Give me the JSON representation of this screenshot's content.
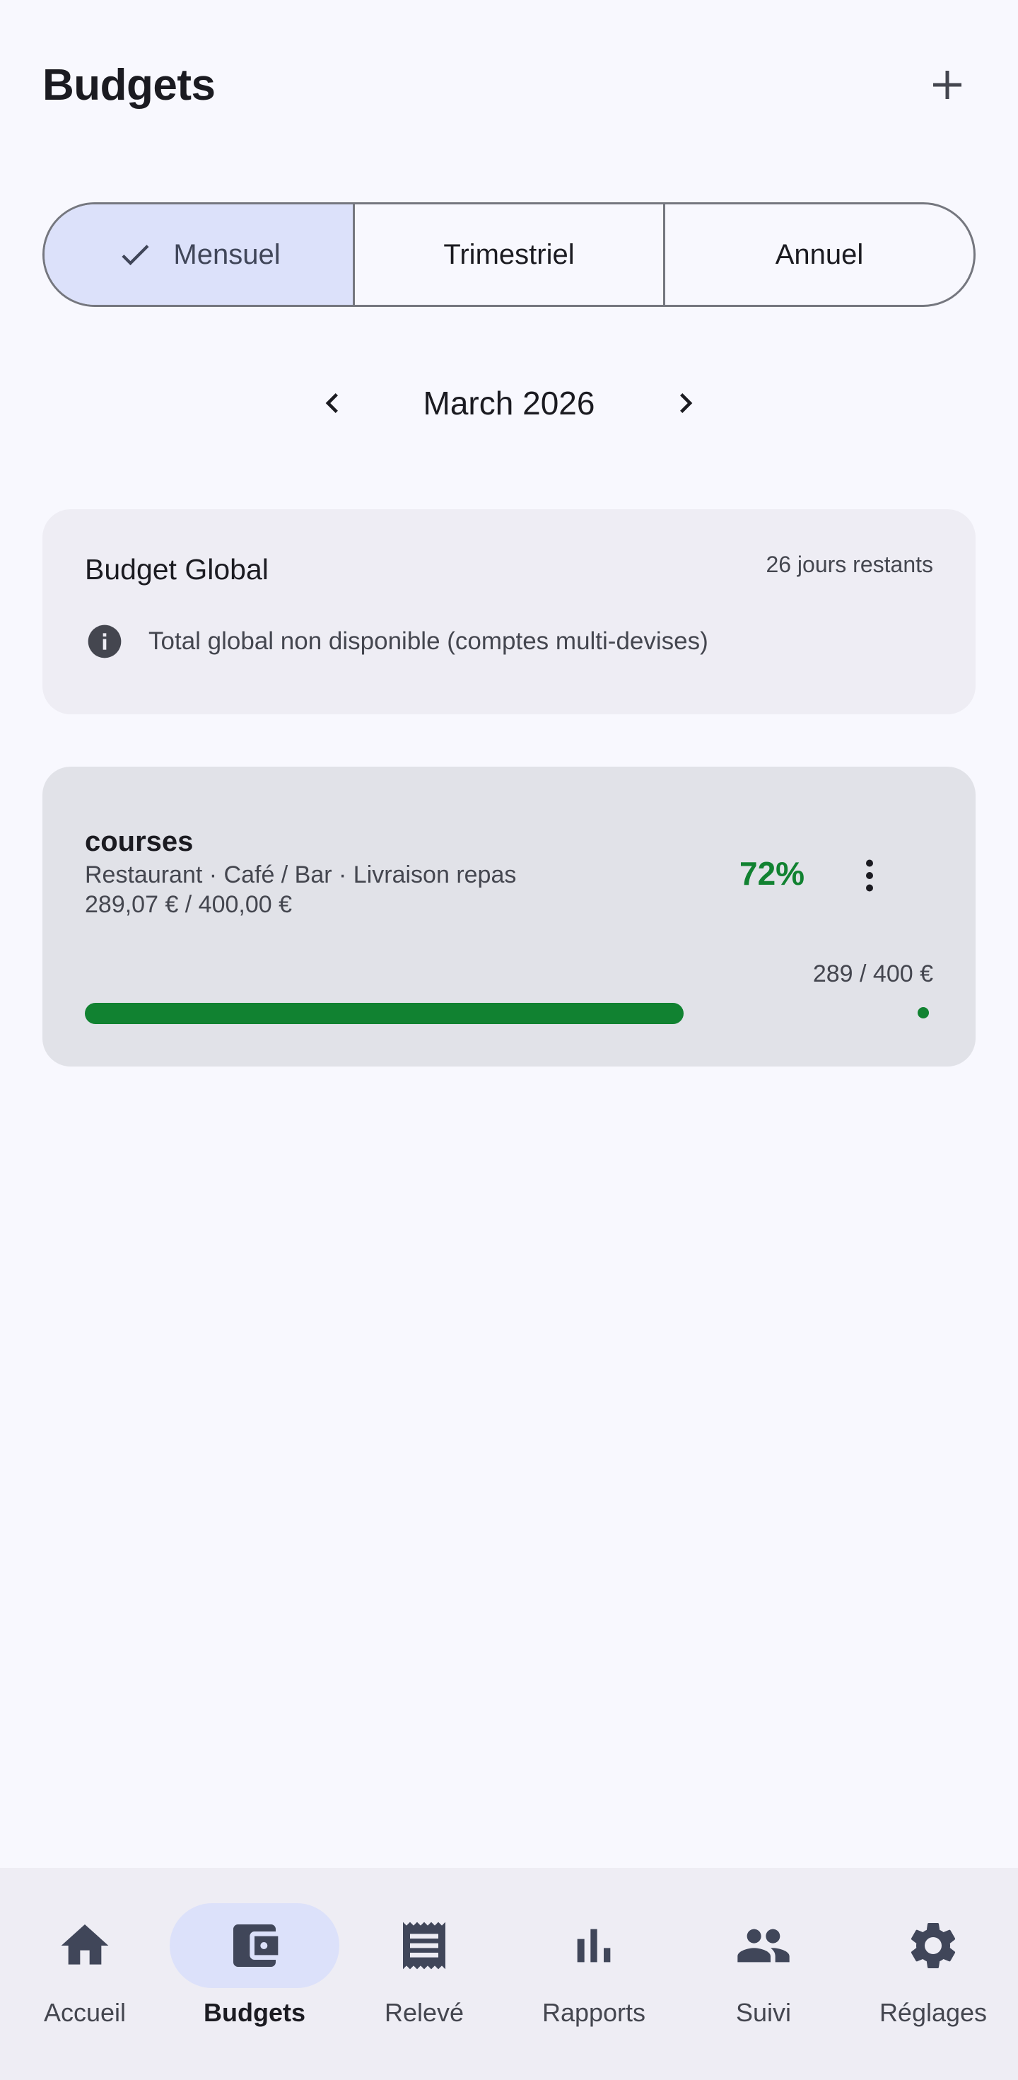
{
  "header": {
    "title": "Budgets",
    "add_icon": "plus-icon"
  },
  "period_tabs": [
    {
      "label": "Mensuel",
      "selected": true,
      "icon": "check-icon"
    },
    {
      "label": "Trimestriel",
      "selected": false
    },
    {
      "label": "Annuel",
      "selected": false
    }
  ],
  "period": {
    "label": "March 2026",
    "prev_icon": "chevron-left-icon",
    "next_icon": "chevron-right-icon"
  },
  "global_budget": {
    "title": "Budget Global",
    "days_left": "26 jours restants",
    "info_icon": "info-icon",
    "info_text": "Total global non disponible (comptes multi-devises)"
  },
  "budgets": [
    {
      "name": "courses",
      "categories": "Restaurant · Café / Bar · Livraison repas",
      "amount": "289,07 € / 400,00 €",
      "percent": "72%",
      "compact": "289 / 400 €",
      "progress": 0.72
    }
  ],
  "colors": {
    "accent": "#dce1fa",
    "progress": "#118231",
    "background": "#f8f8fe"
  },
  "bottom_nav": [
    {
      "label": "Accueil",
      "icon": "home-icon",
      "active": false
    },
    {
      "label": "Budgets",
      "icon": "wallet-icon",
      "active": true
    },
    {
      "label": "Relevé",
      "icon": "receipt-icon",
      "active": false
    },
    {
      "label": "Rapports",
      "icon": "bar-chart-icon",
      "active": false
    },
    {
      "label": "Suivi",
      "icon": "people-icon",
      "active": false
    },
    {
      "label": "Réglages",
      "icon": "settings-icon",
      "active": false
    }
  ]
}
